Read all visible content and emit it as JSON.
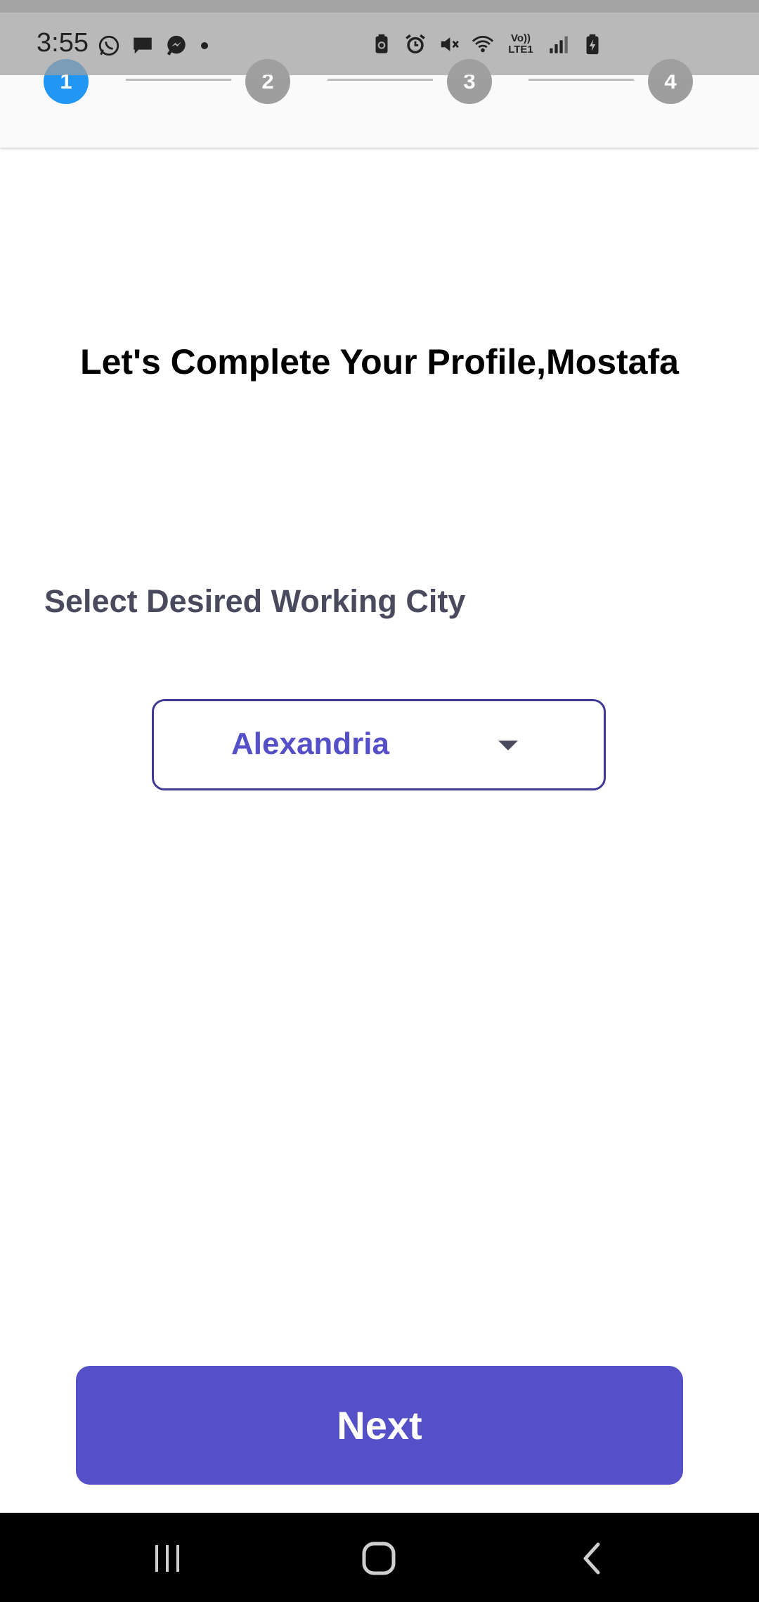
{
  "status_bar": {
    "time": "3:55",
    "network_label": "Vo)) LTE1",
    "left_icons": [
      "whatsapp-icon",
      "message-icon",
      "messenger-icon",
      "notification-dot-icon"
    ],
    "right_icons": [
      "battery-saver-icon",
      "alarm-icon",
      "mute-icon",
      "wifi-icon",
      "volte-lte-icon",
      "signal-icon",
      "battery-charging-icon"
    ]
  },
  "stepper": {
    "steps": [
      "1",
      "2",
      "3",
      "4"
    ],
    "active_step": 1,
    "colors": {
      "active": "#2196f3",
      "inactive": "#9e9e9e"
    }
  },
  "main": {
    "title": "Let's Complete Your Profile,Mostafa",
    "city_label": "Select Desired Working City",
    "city_select": {
      "value": "Alexandria"
    }
  },
  "footer": {
    "next_label": "Next"
  },
  "nav_bar": {
    "buttons": [
      "recent-apps-icon",
      "home-icon",
      "back-icon"
    ]
  },
  "colors": {
    "primary": "#5650c8",
    "select_border": "#3f3a94",
    "label_text": "#4a4a5e"
  }
}
